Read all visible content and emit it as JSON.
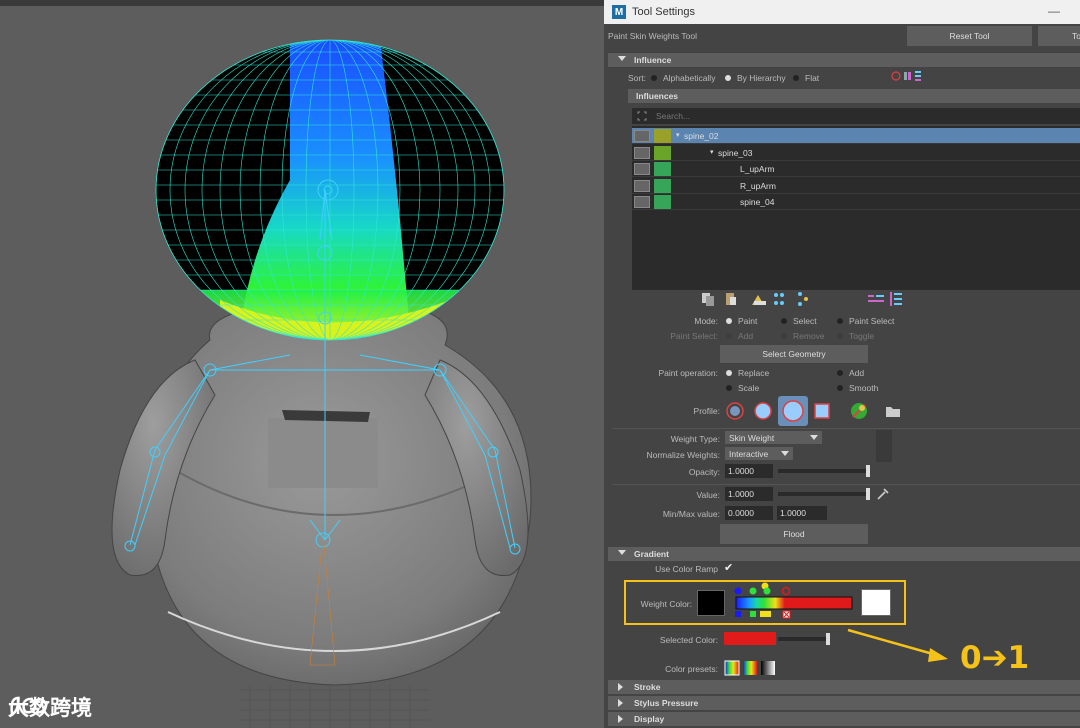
{
  "panel": {
    "window_title": "Tool Settings",
    "tool_name": "Paint Skin Weights Tool",
    "reset_button": "Reset Tool",
    "tool_help_button": "To"
  },
  "influence": {
    "section": "Influence",
    "sort_label": "Sort:",
    "sort_options": [
      "Alphabetically",
      "By Hierarchy",
      "Flat"
    ],
    "sort_selected": "By Hierarchy",
    "list_header": "Influences",
    "search_placeholder": "Search...",
    "items": [
      {
        "name": "spine_02",
        "color": "#9aa12a",
        "selected": true
      },
      {
        "name": "spine_03",
        "color": "#6aa52a",
        "selected": false
      },
      {
        "name": "L_upArm",
        "color": "#36a55a",
        "selected": false
      },
      {
        "name": "R_upArm",
        "color": "#36a55a",
        "selected": false
      },
      {
        "name": "spine_04",
        "color": "#36a55a",
        "selected": false
      }
    ]
  },
  "mode": {
    "label": "Mode:",
    "options": [
      "Paint",
      "Select",
      "Paint Select"
    ],
    "selected": "Paint",
    "paint_select_label": "Paint Select:",
    "paint_select_options": [
      "Add",
      "Remove",
      "Toggle"
    ],
    "select_geometry_button": "Select Geometry"
  },
  "paint_operation": {
    "label": "Paint operation:",
    "options": [
      "Replace",
      "Add",
      "Scale",
      "Smooth"
    ],
    "selected": "Replace"
  },
  "profile": {
    "label": "Profile:",
    "selected_index": 2
  },
  "weights": {
    "weight_type_label": "Weight Type:",
    "weight_type_value": "Skin Weight",
    "normalize_label": "Normalize Weights:",
    "normalize_value": "Interactive",
    "opacity_label": "Opacity:",
    "opacity_value": "1.0000",
    "opacity_level": 1.0,
    "value_label": "Value:",
    "value_value": "1.0000",
    "value_level": 1.0,
    "minmax_label": "Min/Max value:",
    "min_value": "0.0000",
    "max_value": "1.0000",
    "flood_button": "Flood"
  },
  "gradient": {
    "section": "Gradient",
    "use_color_ramp_label": "Use Color Ramp",
    "use_color_ramp_checked": true,
    "weight_color_label": "Weight Color:",
    "weight_color_low": "#000000",
    "weight_color_high": "#ffffff",
    "selected_color_label": "Selected Color:",
    "selected_color": "#e11a1a",
    "color_presets_label": "Color presets:"
  },
  "collapsed_sections": [
    "Stroke",
    "Stylus Pressure",
    "Display"
  ],
  "annotation": {
    "text": "0➔1",
    "color": "#f5c21a"
  },
  "watermark": {
    "text": "大数跨境"
  }
}
